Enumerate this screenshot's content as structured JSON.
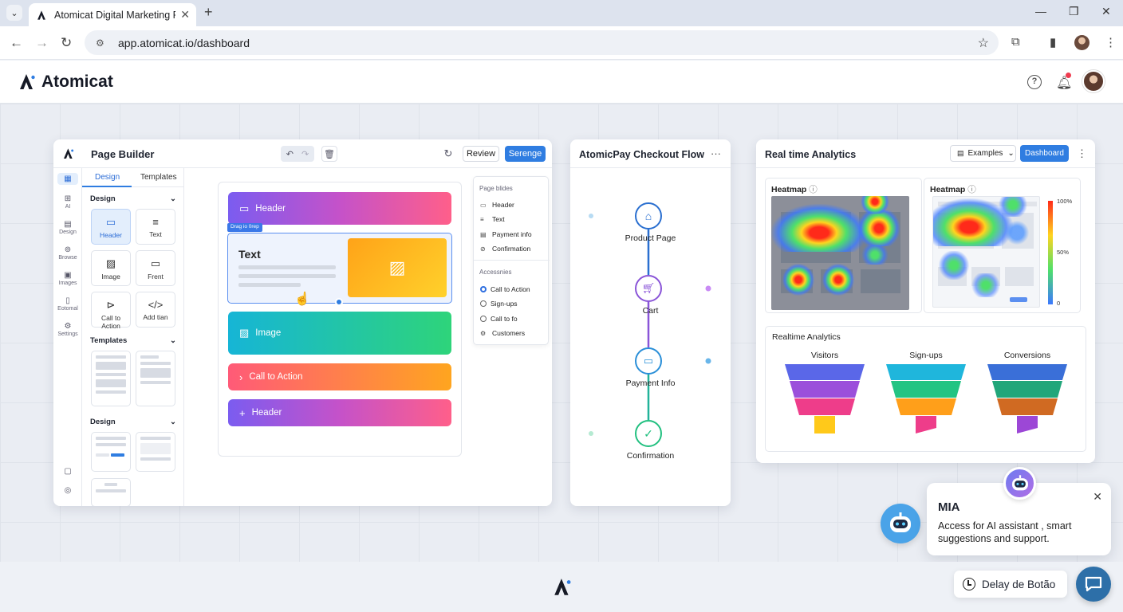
{
  "browser": {
    "tab_title": "Atomicat Digital Marketing Pla",
    "url": "app.atomicat.io/dashboard"
  },
  "app": {
    "brand": "Atomicat",
    "help_icon": "?"
  },
  "page_builder": {
    "title": "Page Builder",
    "review_label": "Review",
    "primary_label": "Serenge",
    "rail": [
      {
        "icon": "grid-icon",
        "label": ""
      },
      {
        "icon": "ai-icon",
        "label": "AI"
      },
      {
        "icon": "design-icon",
        "label": "Design"
      },
      {
        "icon": "browse-icon",
        "label": "Browse"
      },
      {
        "icon": "images-icon",
        "label": "Images"
      },
      {
        "icon": "editorial-icon",
        "label": "Eotomal"
      },
      {
        "icon": "settings-icon",
        "label": "Settings"
      }
    ],
    "side_tabs": [
      "Design",
      "Templates"
    ],
    "sections": {
      "design": "Design",
      "templates": "Templates",
      "design2": "Design"
    },
    "tiles": [
      "Header",
      "Text",
      "Image",
      "Frent",
      "Call to Action",
      "Add tian"
    ],
    "canvas": {
      "header": "Header",
      "text_title": "Text",
      "drag_tag": "Drag io 0rep",
      "image": "Image",
      "cta": "Call to Action",
      "header2": "Header"
    },
    "palette": {
      "group1": "Page blides",
      "items1": [
        "Header",
        "Text",
        "Payment info",
        "Confirmation"
      ],
      "group2": "Accessnies",
      "items2": [
        "Call to Action",
        "Sign-ups",
        "Call to fo",
        "Customers"
      ]
    }
  },
  "checkout_flow": {
    "title": "AtomicPay Checkout Flow",
    "more": "···",
    "steps": [
      "Product Page",
      "Cart",
      "Payment Info",
      "Confirmation"
    ]
  },
  "analytics": {
    "title": "Real time Analytics",
    "examples_label": "Examples",
    "dashboard_label": "Dashboard",
    "heatmap1": "Heatmap",
    "heatmap2": "Heatmap",
    "scale": [
      "100%",
      "50%",
      "0"
    ],
    "funnel_title": "Realtime Analytics",
    "funnels": [
      "Visitors",
      "Sign-ups",
      "Conversions"
    ]
  },
  "mia": {
    "title": "MIA",
    "desc": "Access for AI assistant , smart suggestions and support."
  },
  "delay_label": "Delay de Botão",
  "colors": {
    "primary": "#2f7de1",
    "header_grad": [
      "#7b5cf0",
      "#ff5f8a"
    ],
    "text_grad": [
      "#ffb21e",
      "#ffcf2a"
    ],
    "image_grad": [
      "#16b5d6",
      "#2ed47a"
    ],
    "cta_grad": [
      "#ff5a78",
      "#ffa51f"
    ]
  }
}
